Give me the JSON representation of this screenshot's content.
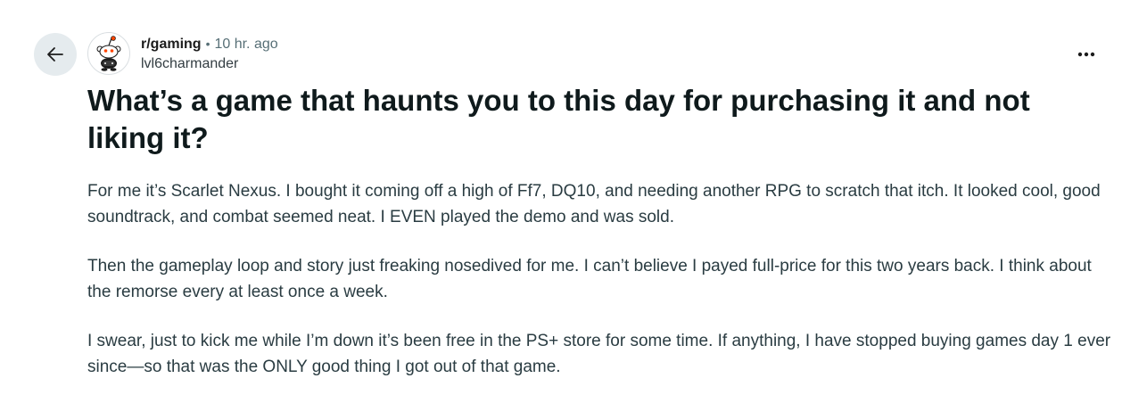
{
  "post": {
    "subreddit": "r/gaming",
    "separator": "•",
    "time": "10 hr. ago",
    "author": "lvl6charmander",
    "title": "What’s a game that haunts you to this day for purchasing it and not liking it?",
    "paragraphs": [
      "For me it’s Scarlet Nexus. I bought it coming off a high of Ff7, DQ10, and needing another RPG to scratch that itch. It looked cool, good soundtrack, and combat seemed neat. I EVEN played the demo and was sold.",
      "Then the gameplay loop and story just freaking nosedived for me. I can’t believe I payed full-price for this two years back. I think about the remorse every at least once a week.",
      "I swear, just to kick me while I’m down it’s been free in the PS+ store for some time. If anything, I have stopped buying games day 1 ever since—so that was the ONLY good thing I got out of that game."
    ]
  },
  "icons": {
    "back": "arrow-left-icon",
    "avatar": "snoo-avatar-icon",
    "more": "more-horizontal-icon"
  },
  "colors": {
    "back_button_bg": "#e5ebee",
    "muted_text": "#576f76",
    "title_text": "#0f1a1c",
    "body_text": "#2a3c42"
  }
}
